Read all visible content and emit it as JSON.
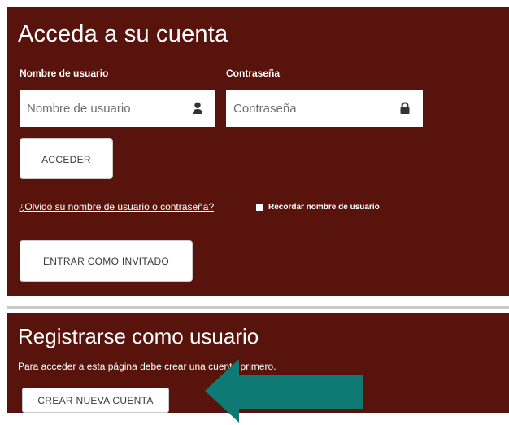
{
  "login": {
    "title": "Acceda a su cuenta",
    "username_label": "Nombre de usuario",
    "username_placeholder": "Nombre de usuario",
    "password_label": "Contraseña",
    "password_placeholder": "Contraseña",
    "login_button": "ACCEDER",
    "forgot_link": "¿Olvidó su nombre de usuario o contraseña?",
    "remember_label": "Recordar nombre de usuario",
    "guest_button": "ENTRAR COMO INVITADO",
    "username_icon": "user-icon",
    "password_icon": "lock-icon"
  },
  "register": {
    "title": "Registrarse como usuario",
    "description": "Para acceder a esta página debe crear una cuenta primero.",
    "create_button": "CREAR NUEVA CUENTA"
  },
  "annotation": {
    "arrow_icon": "left-arrow-icon",
    "arrow_color": "#0e7a73"
  },
  "colors": {
    "panel_background": "#58130c",
    "button_background": "#ffffff"
  }
}
